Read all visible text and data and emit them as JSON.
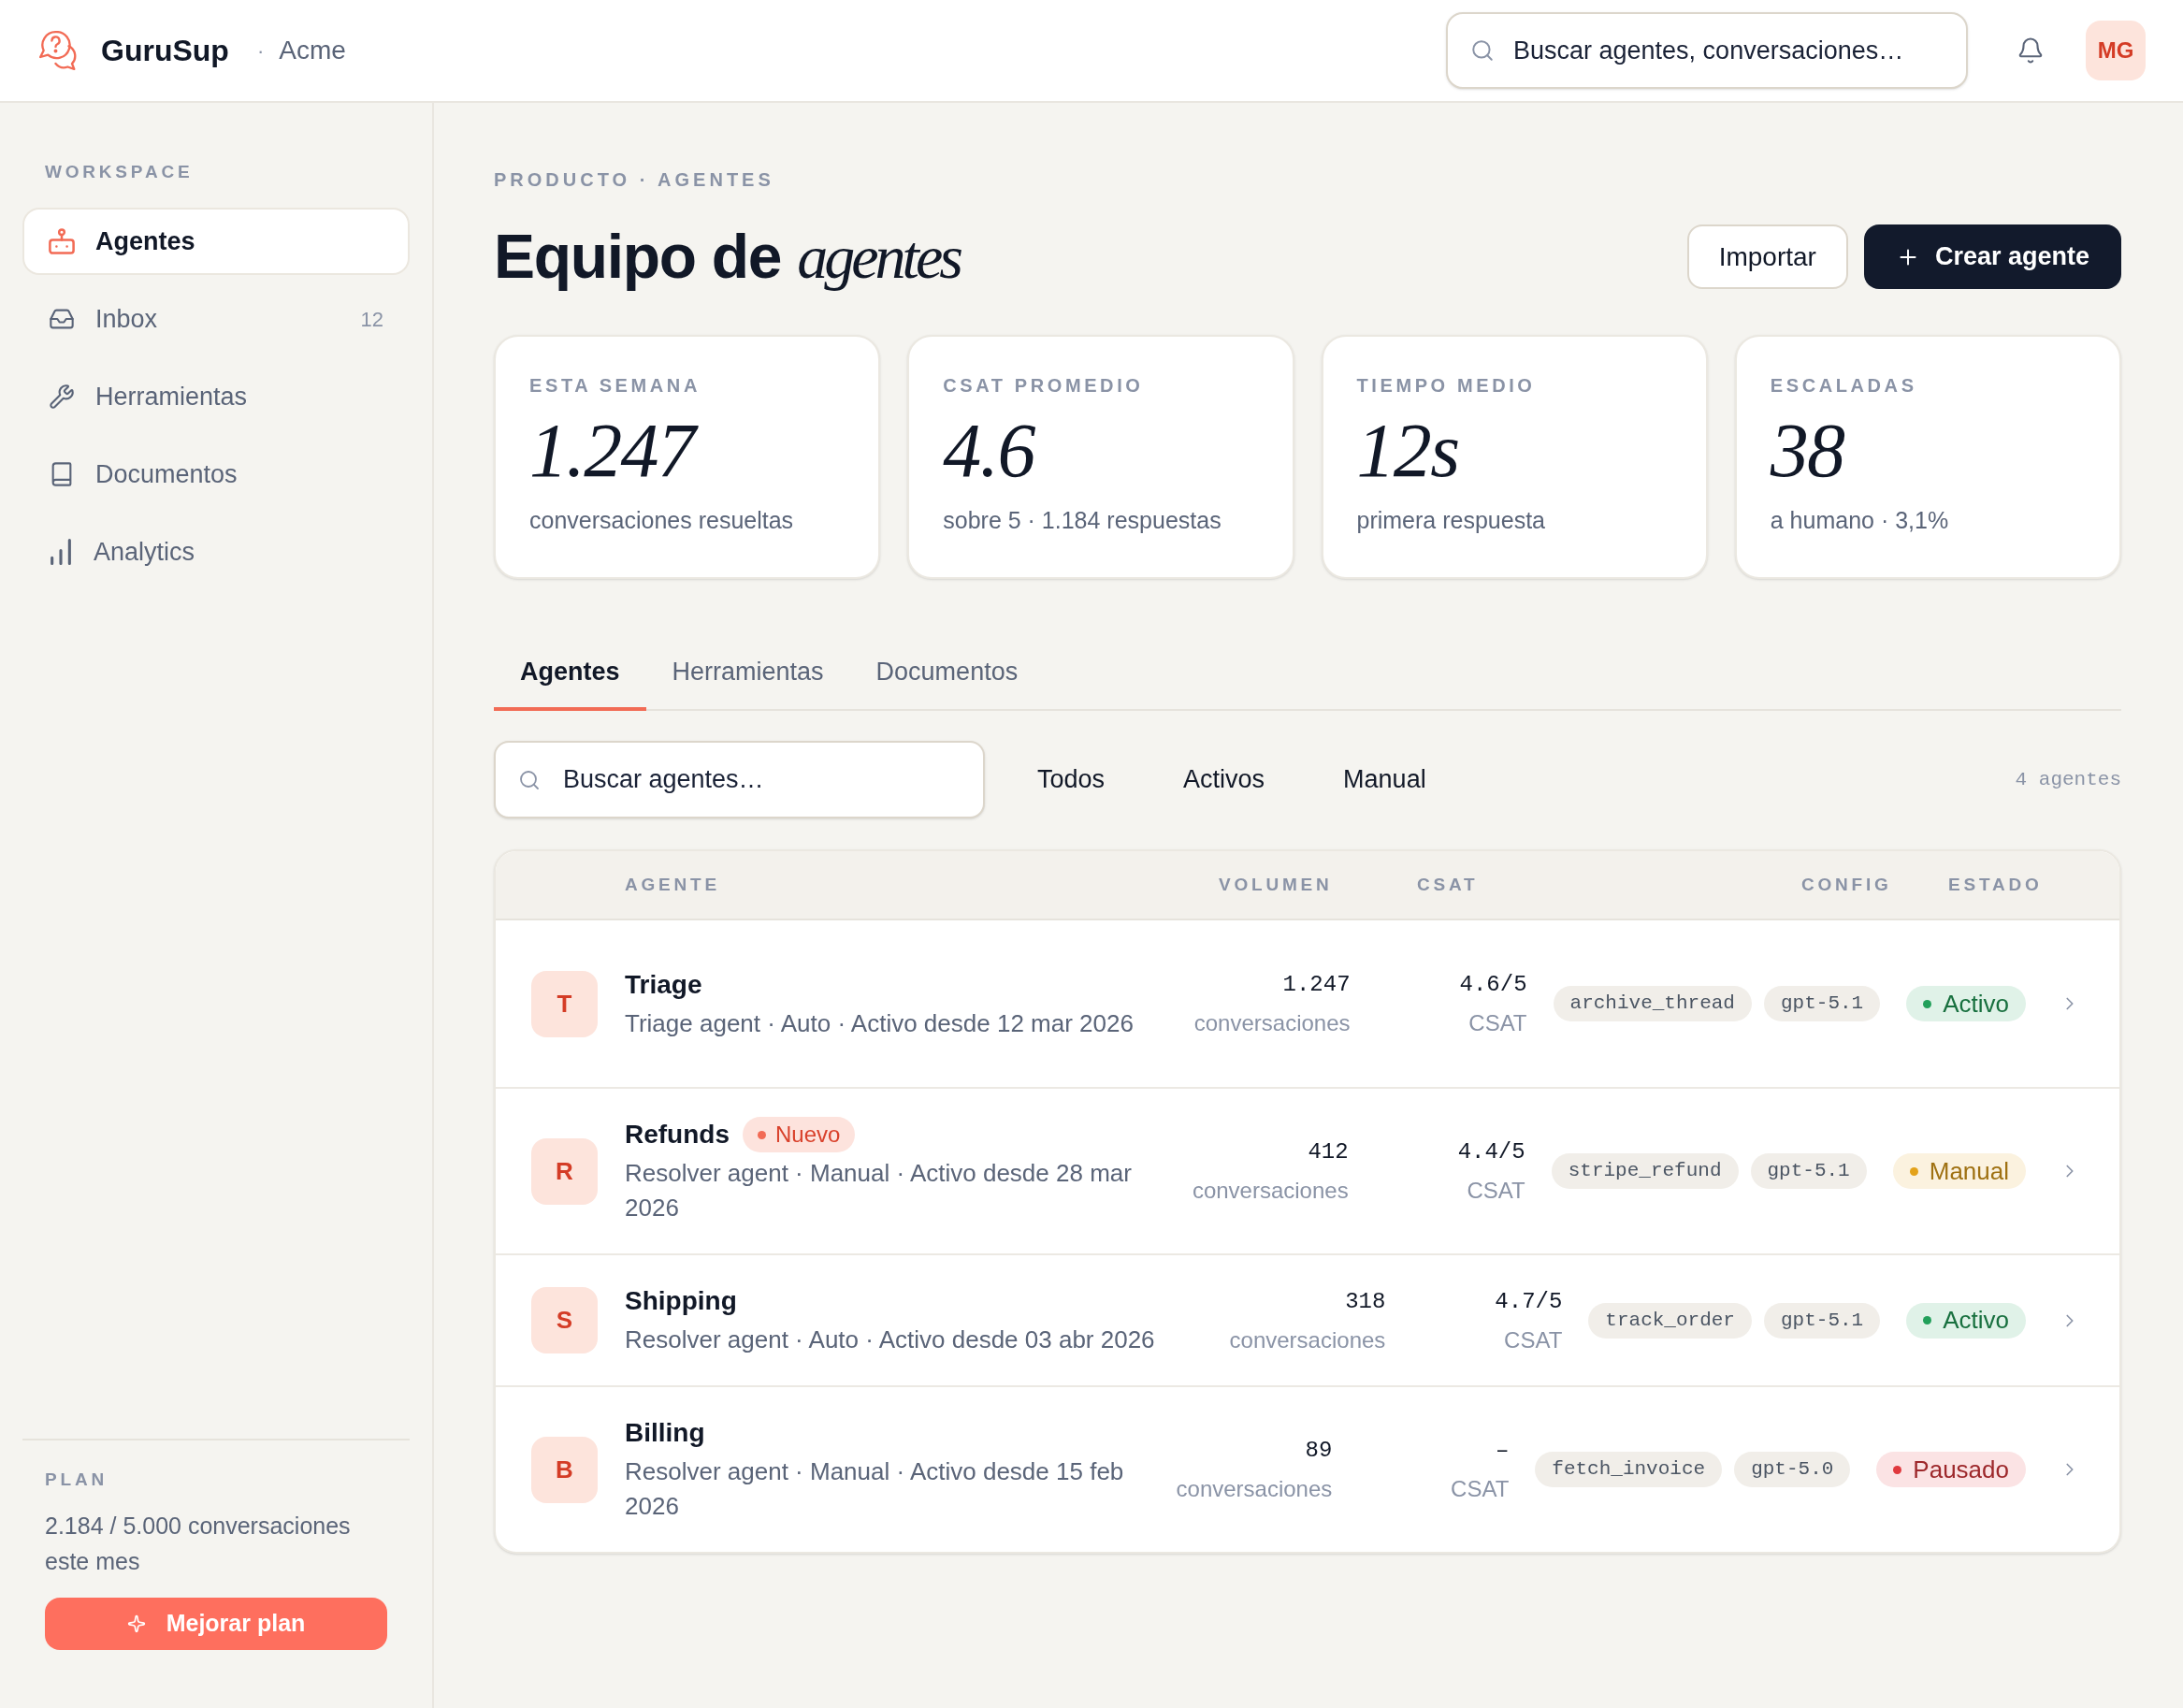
{
  "header": {
    "brand": "GuruSup",
    "separator": "·",
    "workspace": "Acme",
    "search": {
      "placeholder": "Buscar agentes, conversaciones…"
    },
    "avatar": "MG"
  },
  "sidebar": {
    "section": "WORKSPACE",
    "items": [
      {
        "label": "Agentes",
        "selected": true
      },
      {
        "label": "Inbox",
        "count": "12",
        "selected": false
      },
      {
        "label": "Herramientas",
        "selected": false
      },
      {
        "label": "Documentos",
        "selected": false
      },
      {
        "label": "Analytics",
        "selected": false
      }
    ],
    "plan": {
      "label": "PLAN",
      "usage": "2.184 / 5.000 conversaciones este mes",
      "button": "Mejorar plan"
    }
  },
  "page": {
    "breadcrumb": "PRODUCTO · AGENTES",
    "title": "Equipo de *agentes*",
    "buttons": [
      {
        "label": "Importar",
        "kind": "secondary"
      },
      {
        "label": "Crear agente",
        "kind": "primary"
      }
    ]
  },
  "stats": [
    {
      "label": "ESTA SEMANA",
      "value": "1.247",
      "caption": "conversaciones resueltas"
    },
    {
      "label": "CSAT PROMEDIO",
      "value": "4.6",
      "caption": "sobre 5 · 1.184 respuestas"
    },
    {
      "label": "TIEMPO MEDIO",
      "value": "12s",
      "caption": "primera respuesta"
    },
    {
      "label": "ESCALADAS",
      "value": "38",
      "caption": "a humano · 3,1%"
    }
  ],
  "tabs": [
    {
      "label": "Agentes",
      "selected": true
    },
    {
      "label": "Herramientas",
      "selected": false
    },
    {
      "label": "Documentos",
      "selected": false
    }
  ],
  "filters": {
    "search": {
      "placeholder": "Buscar agentes…"
    },
    "options": [
      "Todos",
      "Activos",
      "Manual"
    ],
    "count": "4 agentes"
  },
  "table": {
    "columns": [
      "AGENTE",
      "VOLUMEN",
      "CSAT",
      "CONFIG",
      "ESTADO"
    ],
    "rows": [
      {
        "initial": "T",
        "name": "Triage",
        "description": "Triage agent · Auto · Activo desde 12 mar 2026",
        "volume": "1.247",
        "volume_label": "conversaciones",
        "csat": "4.6/5",
        "csat_label": "CSAT",
        "config": [
          "archive_thread",
          "gpt-5.1"
        ],
        "status": {
          "label": "Activo",
          "color": "#22a05a"
        }
      },
      {
        "initial": "R",
        "name": "Refunds",
        "badge": {
          "label": "Nuevo"
        },
        "description": "Resolver agent · Manual · Activo desde 28 mar 2026",
        "volume": "412",
        "volume_label": "conversaciones",
        "csat": "4.4/5",
        "csat_label": "CSAT",
        "config": [
          "stripe_refund",
          "gpt-5.1"
        ],
        "status": {
          "label": "Manual",
          "color": "#e3a21a"
        }
      },
      {
        "initial": "S",
        "name": "Shipping",
        "description": "Resolver agent · Auto · Activo desde 03 abr 2026",
        "volume": "318",
        "volume_label": "conversaciones",
        "csat": "4.7/5",
        "csat_label": "CSAT",
        "config": [
          "track_order",
          "gpt-5.1"
        ],
        "status": {
          "label": "Activo",
          "color": "#22a05a"
        }
      },
      {
        "initial": "B",
        "name": "Billing",
        "description": "Resolver agent · Manual · Activo desde 15 feb 2026",
        "volume": "89",
        "volume_label": "conversaciones",
        "csat": "–",
        "csat_label": "CSAT",
        "config": [
          "fetch_invoice",
          "gpt-5.0"
        ],
        "status": {
          "label": "Pausado",
          "color": "#e0393e"
        }
      }
    ]
  }
}
